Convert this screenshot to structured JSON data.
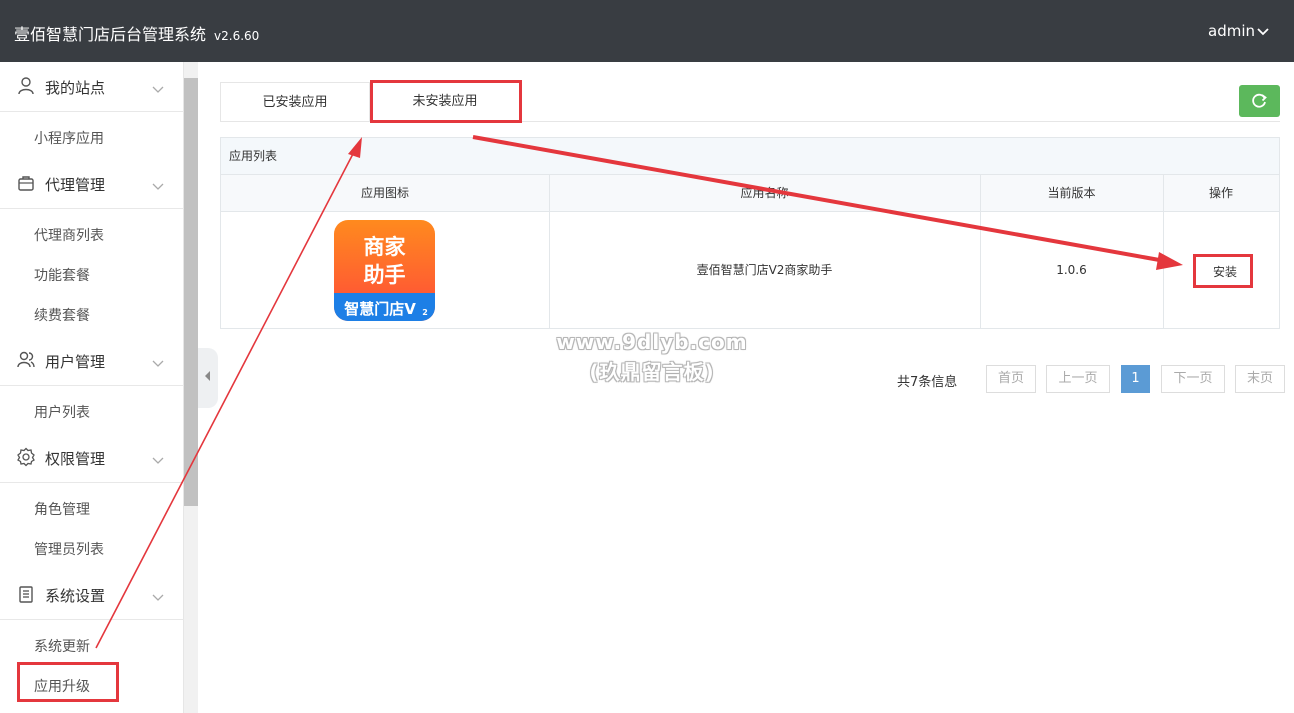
{
  "header": {
    "title": "壹佰智慧门店后台管理系统",
    "version": "v2.6.60",
    "user": "admin"
  },
  "sidebar": {
    "groups": [
      {
        "label": "我的站点",
        "icon": "user-icon",
        "items": [
          "小程序应用"
        ]
      },
      {
        "label": "代理管理",
        "icon": "bag-icon",
        "items": [
          "代理商列表",
          "功能套餐",
          "续费套餐"
        ]
      },
      {
        "label": "用户管理",
        "icon": "users-icon",
        "items": [
          "用户列表"
        ]
      },
      {
        "label": "权限管理",
        "icon": "gear-icon",
        "items": [
          "角色管理",
          "管理员列表"
        ]
      },
      {
        "label": "系统设置",
        "icon": "clipboard-icon",
        "items": [
          "系统更新",
          "应用升级"
        ]
      }
    ]
  },
  "tabs": [
    {
      "label": "已安装应用",
      "active": false
    },
    {
      "label": "未安装应用",
      "active": true
    }
  ],
  "panel": {
    "title": "应用列表",
    "columns": [
      "应用图标",
      "应用名称",
      "当前版本",
      "操作"
    ],
    "rows": [
      {
        "icon_top": "商家",
        "icon_mid": "助手",
        "icon_bottom": "智慧门店V",
        "icon_sup": "2",
        "name": "壹佰智慧门店V2商家助手",
        "version": "1.0.6",
        "action": "安装"
      }
    ]
  },
  "pagination": {
    "info": "共7条信息",
    "first": "首页",
    "prev": "上一页",
    "current": "1",
    "next": "下一页",
    "last": "末页"
  },
  "watermark": {
    "line1": "www.9dlyb.com",
    "line2": "(玖鼎留言板)"
  },
  "colors": {
    "header_bg": "#393d42",
    "accent_green": "#5cb85c",
    "highlight_red": "#e4373d",
    "page_blue": "#5b9bd5"
  }
}
